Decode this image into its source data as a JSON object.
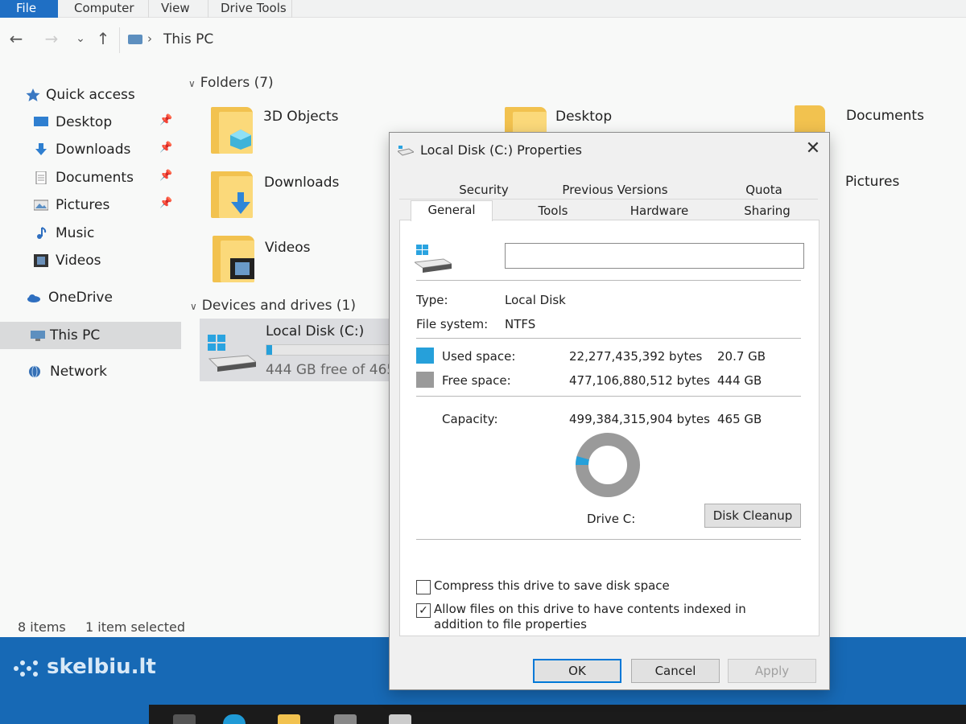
{
  "ribbon": {
    "tabs": [
      "File",
      "Computer",
      "View",
      "Drive Tools"
    ]
  },
  "address": {
    "breadcrumb": "This PC"
  },
  "nav": {
    "quick_access": "Quick access",
    "items": [
      {
        "label": "Desktop",
        "icon": "desktop-icon",
        "pinned": true
      },
      {
        "label": "Downloads",
        "icon": "downloads-icon",
        "pinned": true
      },
      {
        "label": "Documents",
        "icon": "documents-icon",
        "pinned": true
      },
      {
        "label": "Pictures",
        "icon": "pictures-icon",
        "pinned": true
      },
      {
        "label": "Music",
        "icon": "music-icon",
        "pinned": false
      },
      {
        "label": "Videos",
        "icon": "videos-icon",
        "pinned": false
      }
    ],
    "onedrive": "OneDrive",
    "this_pc": "This PC",
    "network": "Network"
  },
  "content": {
    "folders_header": "Folders (7)",
    "folders": [
      {
        "label": "3D Objects"
      },
      {
        "label": "Desktop"
      },
      {
        "label": "Documents"
      },
      {
        "label": "Downloads"
      },
      {
        "label": "Pictures"
      },
      {
        "label": "Videos"
      }
    ],
    "devices_header": "Devices and drives (1)",
    "drive": {
      "name": "Local Disk (C:)",
      "free_text": "444 GB free of 465 G",
      "used_fraction": 0.045
    }
  },
  "status": {
    "count": "8 items",
    "selected": "1 item selected"
  },
  "watermark": "skelbiu.lt",
  "dialog": {
    "title": "Local Disk (C:) Properties",
    "close": "✕",
    "tabs": {
      "security": "Security",
      "previous_versions": "Previous Versions",
      "quota": "Quota",
      "general": "General",
      "tools": "Tools",
      "hardware": "Hardware",
      "sharing": "Sharing"
    },
    "volume_label": "",
    "type_label": "Type:",
    "type_value": "Local Disk",
    "fs_label": "File system:",
    "fs_value": "NTFS",
    "used_label": "Used space:",
    "used_bytes": "22,277,435,392 bytes",
    "used_gb": "20.7 GB",
    "free_label": "Free space:",
    "free_bytes": "477,106,880,512 bytes",
    "free_gb": "444 GB",
    "capacity_label": "Capacity:",
    "capacity_bytes": "499,384,315,904 bytes",
    "capacity_gb": "465 GB",
    "used_fraction": 0.0446,
    "drive_caption": "Drive C:",
    "cleanup": "Disk Cleanup",
    "compress_label": "Compress this drive to save disk space",
    "compress_checked": false,
    "index_label": "Allow files on this drive to have contents indexed in addition to file properties",
    "index_checked": true,
    "ok": "OK",
    "cancel": "Cancel",
    "apply": "Apply",
    "colors": {
      "used": "#26a0da",
      "free": "#9a9a9a"
    }
  }
}
